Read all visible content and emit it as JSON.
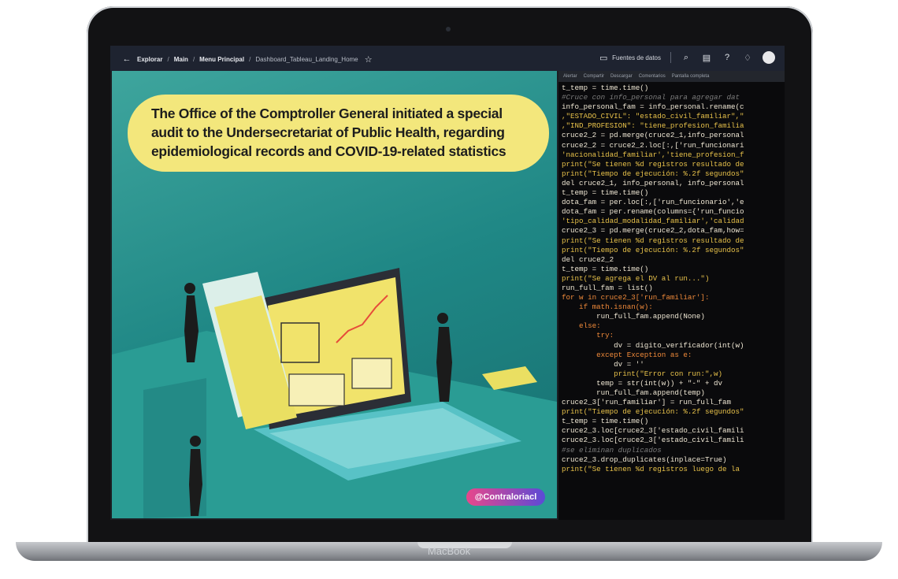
{
  "device": {
    "brand_label": "MacBook"
  },
  "browser": {
    "breadcrumbs": [
      "Explorar",
      "Main",
      "Menu Principal",
      "Dashboard_Tableau_Landing_Home"
    ],
    "data_sources_label": "Fuentes de datos"
  },
  "poster": {
    "headline": "The Office of the Comptroller General initiated a special audit to the Undersecretariat of Public Health, regarding epidemiological records and COVID-19-related statistics",
    "handle": "@Contraloriacl"
  },
  "notebook": {
    "toolbar": [
      "Alertar",
      "Compartir",
      "Descargar",
      "Comentarios",
      "Pantalla completa"
    ],
    "lines": [
      {
        "t": "t_temp = time.time()",
        "c": "var"
      },
      {
        "t": "#Cruce con info_personal para agregar dat",
        "c": "comment"
      },
      {
        "t": "info_personal_fam = info_personal.rename(c",
        "c": "var"
      },
      {
        "t": ",\"ESTADO_CIVIL\": \"estado_civil_familiar\",\"",
        "c": "str"
      },
      {
        "t": ",\"IND_PROFESION\": \"tiene_profesion_familia",
        "c": "str"
      },
      {
        "t": "cruce2_2 = pd.merge(cruce2_1,info_personal",
        "c": "var"
      },
      {
        "t": "cruce2_2 = cruce2_2.loc[:,['run_funcionari",
        "c": "var"
      },
      {
        "t": "'nacionalidad_familiar','tiene_profesion_f",
        "c": "str"
      },
      {
        "t": "print(\"Se tienen %d registros resultado de",
        "c": "str"
      },
      {
        "t": "print(\"Tiempo de ejecución: %.2f segundos\"",
        "c": "str"
      },
      {
        "t": "del cruce2_1, info_personal, info_personal",
        "c": "var"
      },
      {
        "t": "t_temp = time.time()",
        "c": "var"
      },
      {
        "t": "dota_fam = per.loc[:,['run_funcionario','e",
        "c": "var"
      },
      {
        "t": "dota_fam = per.rename(columns={'run_funcio",
        "c": "var"
      },
      {
        "t": "'tipo_calidad_modalidad_familiar','calidad",
        "c": "str"
      },
      {
        "t": "cruce2_3 = pd.merge(cruce2_2,dota_fam,how=",
        "c": "var"
      },
      {
        "t": "print(\"Se tienen %d registros resultado de",
        "c": "str"
      },
      {
        "t": "print(\"Tiempo de ejecución: %.2f segundos\"",
        "c": "str"
      },
      {
        "t": "del cruce2_2",
        "c": "var"
      },
      {
        "t": "t_temp = time.time()",
        "c": "var"
      },
      {
        "t": "print(\"Se agrega el DV al run...\")",
        "c": "str"
      },
      {
        "t": "run_full_fam = list()",
        "c": "var"
      },
      {
        "t": "for w in cruce2_3['run_familiar']:",
        "c": "kw"
      },
      {
        "t": "    if math.isnan(w):",
        "c": "kw"
      },
      {
        "t": "        run_full_fam.append(None)",
        "c": "var"
      },
      {
        "t": "    else:",
        "c": "kw"
      },
      {
        "t": "        try:",
        "c": "kw"
      },
      {
        "t": "            dv = digito_verificador(int(w)",
        "c": "var"
      },
      {
        "t": "        except Exception as e:",
        "c": "kw"
      },
      {
        "t": "            dv = ''",
        "c": "var"
      },
      {
        "t": "            print(\"Error con run:\",w)",
        "c": "str"
      },
      {
        "t": "        temp = str(int(w)) + \"-\" + dv",
        "c": "var"
      },
      {
        "t": "        run_full_fam.append(temp)",
        "c": "var"
      },
      {
        "t": "cruce2_3['run_familiar'] = run_full_fam",
        "c": "var"
      },
      {
        "t": "print(\"Tiempo de ejecución: %.2f segundos\"",
        "c": "str"
      },
      {
        "t": "t_temp = time.time()",
        "c": "var"
      },
      {
        "t": "cruce2_3.loc[cruce2_3['estado_civil_famili",
        "c": "var"
      },
      {
        "t": "cruce2_3.loc[cruce2_3['estado_civil_famili",
        "c": "var"
      },
      {
        "t": "#se eliminan duplicados",
        "c": "comment"
      },
      {
        "t": "cruce2_3.drop_duplicates(inplace=True)",
        "c": "var"
      },
      {
        "t": "print(\"Se tienen %d registros luego de la",
        "c": "str"
      }
    ]
  }
}
